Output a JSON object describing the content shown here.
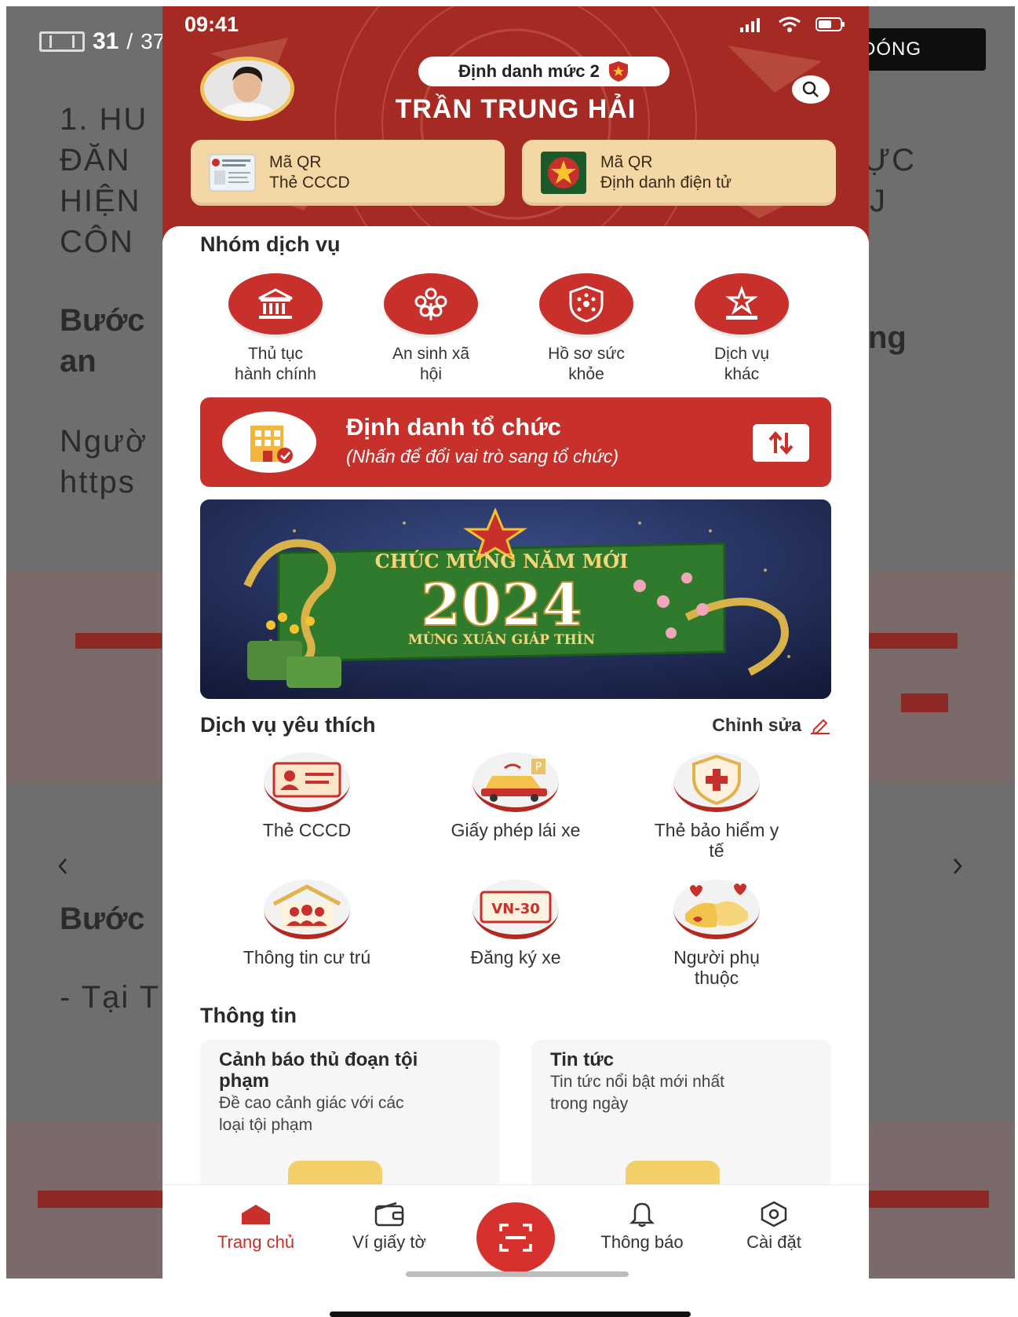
{
  "viewer": {
    "page_current": "31",
    "page_separator": "/",
    "page_total": "37",
    "close_label": "ĐÓNG",
    "bg_lines": [
      "1. HU",
      "ĐĂN",
      "HIỆN",
      "CÔN",
      "Bước",
      "an",
      "Ngườ",
      "https",
      "Bước",
      "- Tại T",
      "ỰC",
      "J",
      "ng"
    ]
  },
  "status_bar": {
    "time": "09:41"
  },
  "profile": {
    "level_label": "Định danh mức 2",
    "name": "TRẦN TRUNG HẢI"
  },
  "qr_cards": [
    {
      "line1": "Mã QR",
      "line2": "Thẻ CCCD",
      "icon": "id-card-icon"
    },
    {
      "line1": "Mã QR",
      "line2": "Định danh điện tử",
      "icon": "police-emblem-icon"
    }
  ],
  "service_groups": {
    "title": "Nhóm dịch vụ",
    "items": [
      {
        "line1": "Thủ tục",
        "line2": "hành chính",
        "icon": "government-building-icon"
      },
      {
        "line1": "An sinh xã",
        "line2": "hội",
        "icon": "social-welfare-icon"
      },
      {
        "line1": "Hồ sơ sức",
        "line2": "khỏe",
        "icon": "health-shield-icon"
      },
      {
        "line1": "Dịch vụ",
        "line2": "khác",
        "icon": "star-podium-icon"
      }
    ]
  },
  "org_banner": {
    "title": "Định danh tổ chức",
    "subtitle": "(Nhấn để đổi vai trò sang tổ chức)"
  },
  "promo": {
    "headline": "CHÚC MỪNG NĂM MỚI",
    "year": "2024",
    "tagline": "MỪNG XUÂN GIÁP THÌN"
  },
  "favorites": {
    "title": "Dịch vụ yêu thích",
    "edit_label": "Chỉnh sửa",
    "items": [
      {
        "line1": "Thẻ CCCD",
        "line2": "",
        "icon": "id-card-icon"
      },
      {
        "line1": "Giấy phép lái xe",
        "line2": "",
        "icon": "car-parking-icon"
      },
      {
        "line1": "Thẻ bảo hiểm y",
        "line2": "tế",
        "icon": "medical-shield-icon"
      },
      {
        "line1": "Thông tin cư trú",
        "line2": "",
        "icon": "family-house-icon"
      },
      {
        "line1": "Đăng ký xe",
        "line2": "",
        "icon": "license-plate-icon",
        "plate": "VN-30"
      },
      {
        "line1": "Người phụ",
        "line2": "thuộc",
        "icon": "helping-hands-icon"
      }
    ]
  },
  "info": {
    "title": "Thông tin",
    "cards": [
      {
        "title1": "Cảnh báo thủ đoạn tội",
        "title2": "phạm",
        "desc1": "Đề cao cảnh giác với các",
        "desc2": "loại tội phạm"
      },
      {
        "title1": "Tin tức",
        "title2": "",
        "desc1": "Tin tức nổi bật mới nhất",
        "desc2": "trong ngày"
      }
    ]
  },
  "tabbar": {
    "tabs": [
      {
        "label": "Trang chủ",
        "icon": "home-icon",
        "active": true
      },
      {
        "label": "Ví giấy tờ",
        "icon": "wallet-icon",
        "active": false
      },
      {
        "label": "Thông báo",
        "icon": "bell-icon",
        "active": false
      },
      {
        "label": "Cài đặt",
        "icon": "settings-hexagon-icon",
        "active": false
      }
    ],
    "scan_icon": "scan-icon"
  },
  "colors": {
    "brand_red": "#c8302b",
    "hero_red": "#a62a24",
    "card_gold": "#f3d7a5"
  }
}
